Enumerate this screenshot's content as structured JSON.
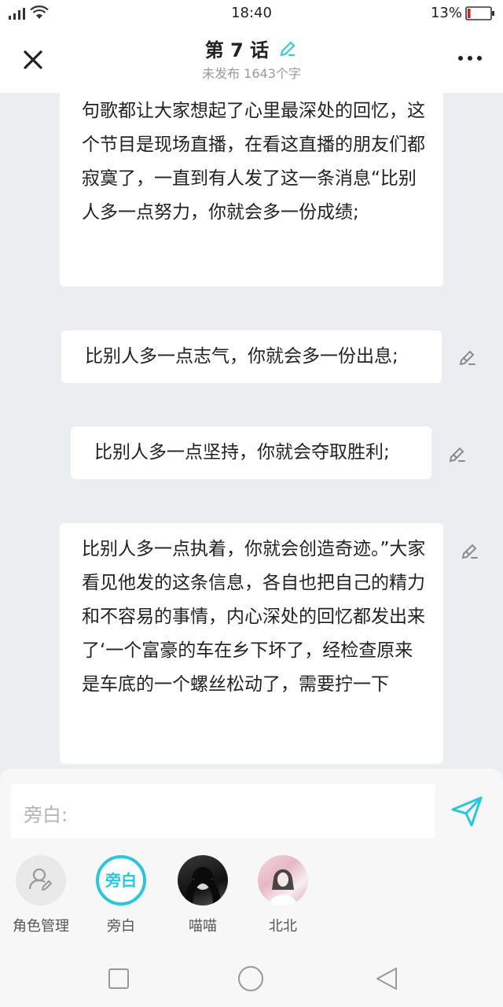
{
  "status_bar": {
    "time": "18:40",
    "battery_percent": "13%",
    "battery_level": 0.13,
    "battery_color": "#e02020",
    "signal_icon": "signal-icon",
    "wifi_icon": "wifi-icon"
  },
  "header": {
    "title": "第 7 话",
    "subtitle": "未发布 1643个字",
    "accent_color": "#2cc5d9"
  },
  "messages": [
    {
      "text": "句歌都让大家想起了心里最深处的回忆，这个节目是现场直播，在看这直播的朋友们都寂寞了，一直到有人发了这一条消息“比别人多一点努力，你就会多一份成绩;"
    },
    {
      "text": "比别人多一点志气，你就会多一份出息;"
    },
    {
      "text": "比别人多一点坚持，你就会夺取胜利;"
    },
    {
      "text": "比别人多一点执着，你就会创造奇迹。”大家看见他发的这条信息，各自也把自己的精力和不容易的事情，内心深处的回忆都发出来了‘一个富豪的车在乡下坏了，经检查原来是车底的一个螺丝松动了，需要拧一下"
    }
  ],
  "composer": {
    "placeholder": "旁白:",
    "send_icon": "send-icon"
  },
  "roles": [
    {
      "label": "角色管理",
      "icon": "role-manage-icon"
    },
    {
      "label": "旁白",
      "avatar_text": "旁白",
      "selected": true
    },
    {
      "label": "喵喵"
    },
    {
      "label": "北北"
    }
  ],
  "navbar": {
    "icons": [
      "recent-apps-icon",
      "home-icon",
      "back-icon"
    ]
  }
}
